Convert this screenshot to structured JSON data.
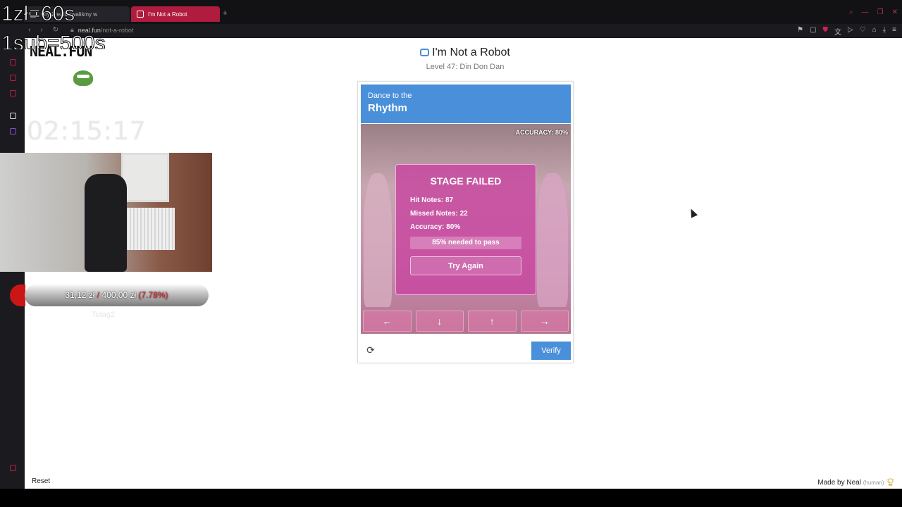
{
  "browser": {
    "tabs": [
      {
        "label": "Gry Zrealizowaliśmy w"
      },
      {
        "label": "I'm Not a Robot"
      }
    ],
    "url_host": "neal.fun",
    "url_path": "/not-a-robot"
  },
  "site": {
    "logo": "NEAL.FUN",
    "title": "I'm Not a Robot",
    "level": "Level 47: Din Don Dan"
  },
  "captcha": {
    "head_small": "Dance to the",
    "head_big": "Rhythm",
    "accuracy_top": "ACCURACY: 80%",
    "fail_title": "STAGE FAILED",
    "hit_notes": "Hit Notes: 87",
    "missed_notes": "Missed Notes: 22",
    "accuracy": "Accuracy: 80%",
    "needed": "85% needed to pass",
    "retry": "Try Again",
    "arrows": [
      "←",
      "↓",
      "↑",
      "→"
    ],
    "verify": "Verify"
  },
  "footer": {
    "reset": "Reset",
    "made_by": "Made by Neal",
    "human": "(human)"
  },
  "overlay": {
    "rate_line1": "1zł=60s",
    "rate_line2": "1sub=500s",
    "timer": "02:15:17",
    "donation_current": "31,12 zł",
    "donation_sep": "/",
    "donation_goal": "400,00 zł",
    "donation_pct": "(7.78%)",
    "donor": "Totag2"
  },
  "colors": {
    "accent_blue": "#4a8fd9",
    "tab_active": "#b01c3e",
    "fail_panel": "#c846a0"
  }
}
